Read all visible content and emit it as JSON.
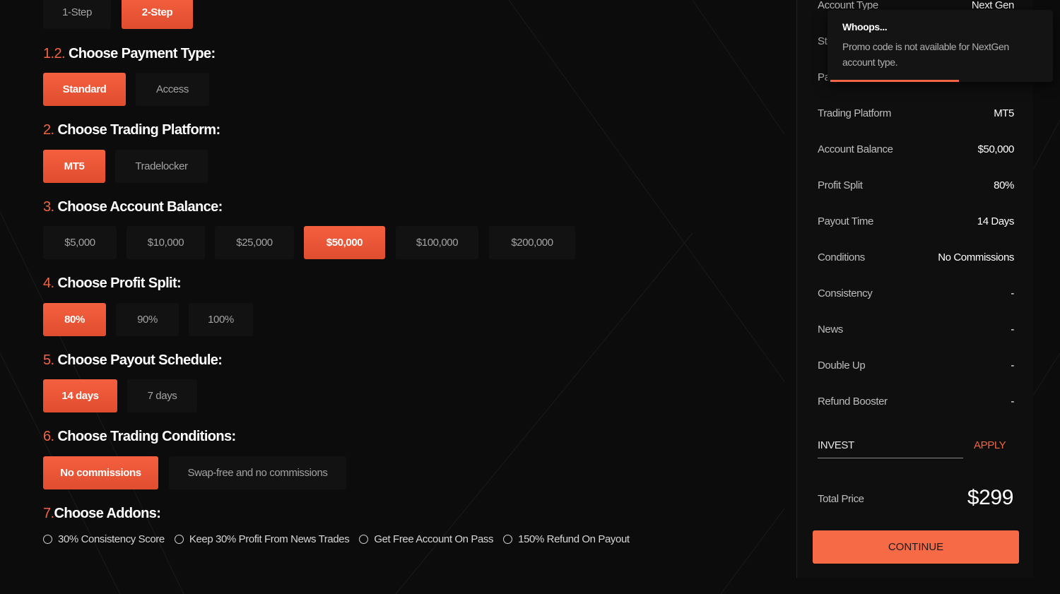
{
  "steps": {
    "options": [
      "1-Step",
      "2-Step"
    ],
    "selected": "2-Step"
  },
  "payment": {
    "num": "1.2.",
    "title": "Choose Payment Type:",
    "options": [
      "Standard",
      "Access"
    ],
    "selected": "Standard"
  },
  "platform": {
    "num": "2.",
    "title": "Choose Trading Platform:",
    "options": [
      "MT5",
      "Tradelocker"
    ],
    "selected": "MT5"
  },
  "balance": {
    "num": "3.",
    "title": "Choose Account Balance:",
    "options": [
      "$5,000",
      "$10,000",
      "$25,000",
      "$50,000",
      "$100,000",
      "$200,000"
    ],
    "selected": "$50,000"
  },
  "split": {
    "num": "4.",
    "title": "Choose Profit Split:",
    "options": [
      "80%",
      "90%",
      "100%"
    ],
    "selected": "80%"
  },
  "payout": {
    "num": "5.",
    "title": "Choose Payout Schedule:",
    "options": [
      "14 days",
      "7 days"
    ],
    "selected": "14 days"
  },
  "conditions": {
    "num": "6.",
    "title": "Choose Trading Conditions:",
    "options": [
      "No commissions",
      "Swap-free and no commissions"
    ],
    "selected": "No commissions"
  },
  "addons": {
    "num": "7.",
    "title": "Choose Addons:",
    "options": [
      "30% Consistency Score",
      "Keep 30% Profit From News Trades",
      "Get Free Account On Pass",
      "150% Refund On Payout"
    ]
  },
  "summary": {
    "rows": [
      {
        "label": "Account Type",
        "value": "Next Gen"
      },
      {
        "label": "St",
        "value": ""
      },
      {
        "label": "Pa",
        "value": ""
      },
      {
        "label": "Trading Platform",
        "value": "MT5"
      },
      {
        "label": "Account Balance",
        "value": "$50,000"
      },
      {
        "label": "Profit Split",
        "value": "80%"
      },
      {
        "label": "Payout Time",
        "value": "14 Days"
      },
      {
        "label": "Conditions",
        "value": "No Commissions"
      },
      {
        "label": "Consistency",
        "value": "-"
      },
      {
        "label": "News",
        "value": "-"
      },
      {
        "label": "Double Up",
        "value": "-"
      },
      {
        "label": "Refund Booster",
        "value": "-"
      }
    ],
    "promo_value": "INVEST",
    "apply_label": "APPLY",
    "total_label": "Total Price",
    "total_value": "$299",
    "continue_label": "CONTINUE"
  },
  "toast": {
    "title": "Whoops...",
    "message": "Promo code is not available for NextGen account type.",
    "progress": 0.57
  },
  "colors": {
    "accent": "#f26544",
    "background": "#0c0c0c",
    "panel": "#0f0f0f",
    "button": "#121212"
  }
}
